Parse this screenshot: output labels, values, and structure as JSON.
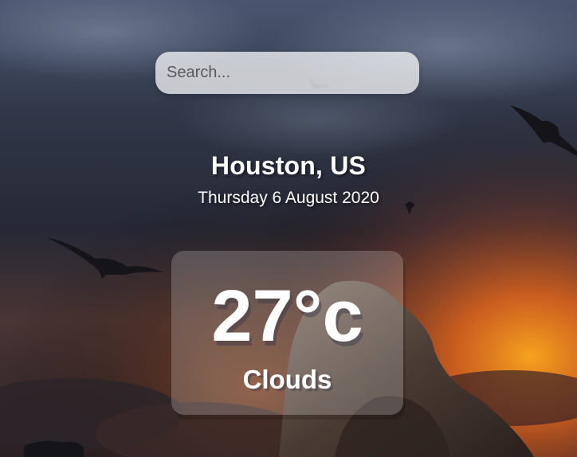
{
  "search": {
    "placeholder": "Search...",
    "value": ""
  },
  "location": {
    "city_country": "Houston, US",
    "date": "Thursday 6 August 2020"
  },
  "weather": {
    "temperature": "27°c",
    "condition": "Clouds"
  },
  "colors": {
    "text": "#ffffff",
    "sky_top": "#3c465c",
    "sunset_glow": "#e0641c"
  }
}
